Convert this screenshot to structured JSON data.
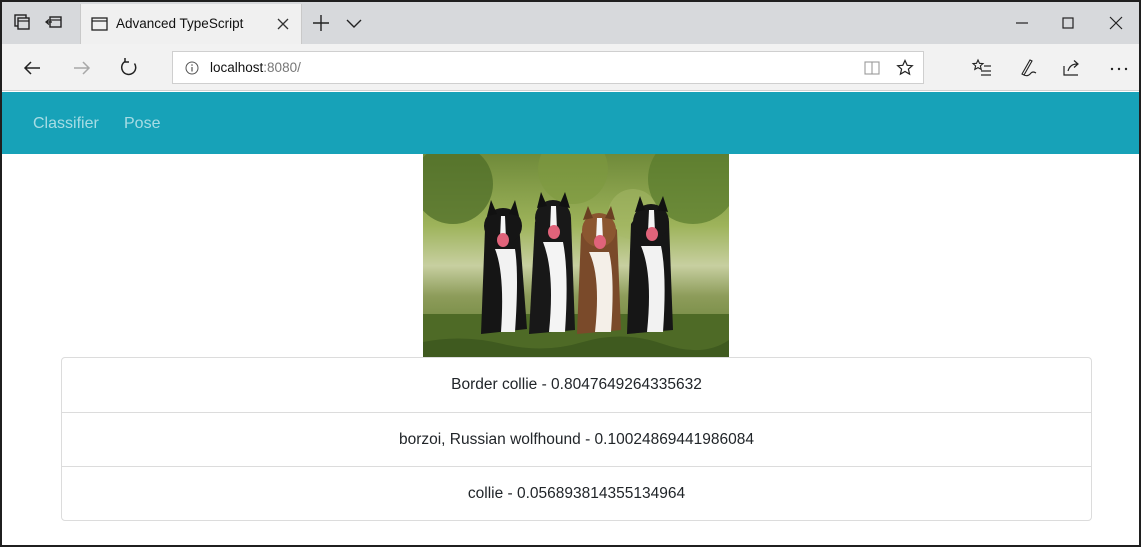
{
  "browser": {
    "tab": {
      "title": "Advanced TypeScript"
    },
    "address": {
      "host": "localhost",
      "port_path": ":8080/"
    }
  },
  "icons": {
    "tab_actions": [
      "tabs-aside-icon",
      "restore-tabs-icon"
    ],
    "toolbar": [
      "favorites-list-icon",
      "pen-icon",
      "share-icon",
      "more-icon"
    ]
  },
  "page": {
    "nav": {
      "items": [
        "Classifier",
        "Pose"
      ]
    },
    "results": [
      {
        "label": "Border collie - 0.8047649264335632"
      },
      {
        "label": "borzoi, Russian wolfhound - 0.10024869441986084"
      },
      {
        "label": "collie - 0.056893814355134964"
      }
    ]
  },
  "colors": {
    "navbar": "#17a2b8",
    "tabbar": "#d7d9dc",
    "addressbar": "#f2f2f2"
  }
}
